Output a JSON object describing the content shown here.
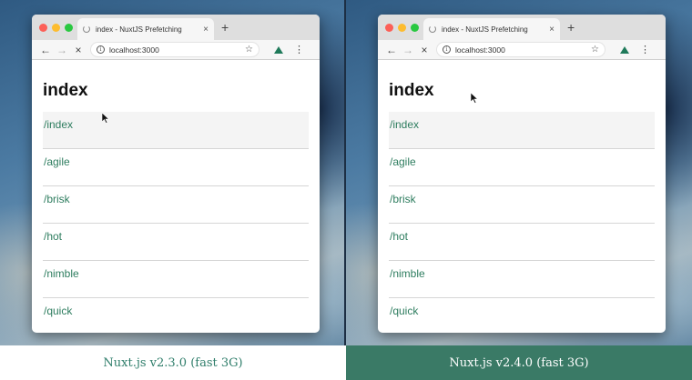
{
  "left": {
    "tab_title": "index - NuxtJS Prefetching",
    "url": "localhost:3000",
    "heading": "index",
    "links": [
      "/index",
      "/agile",
      "/brisk",
      "/hot",
      "/nimble",
      "/quick"
    ],
    "caption": "Nuxt.js v2.3.0 (fast 3G)"
  },
  "right": {
    "tab_title": "index - NuxtJS Prefetching",
    "url": "localhost:3000",
    "heading": "index",
    "links": [
      "/index",
      "/agile",
      "/brisk",
      "/hot",
      "/nimble",
      "/quick"
    ],
    "caption": "Nuxt.js v2.4.0 (fast 3G)"
  },
  "icons": {
    "tab_close": "×",
    "new_tab": "+",
    "back": "←",
    "forward": "→",
    "stop": "×",
    "info": "i",
    "star": "☆",
    "menu": "⋮"
  },
  "colors": {
    "link": "#2e7d5f",
    "caption_left_text": "#2e7d6a",
    "caption_right_bg": "#3a7a66"
  }
}
